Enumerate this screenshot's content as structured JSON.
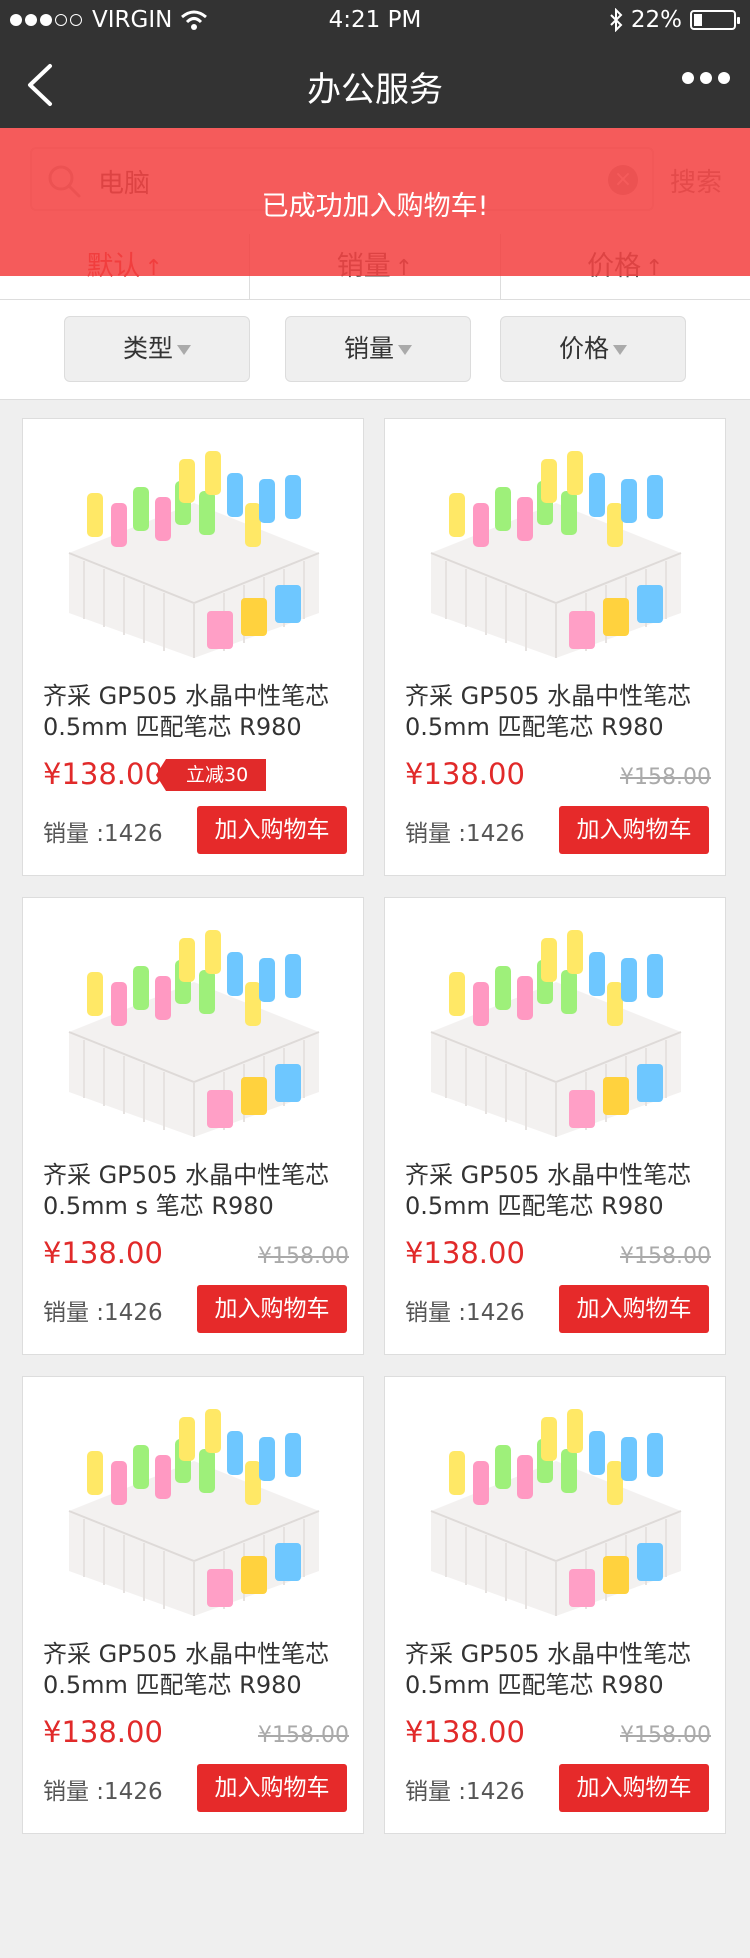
{
  "status_bar": {
    "carrier": "VIRGIN",
    "time": "4:21 PM",
    "battery": "22%",
    "battery_level": 0.22,
    "signal_icon": "signal-dots-icon",
    "wifi_icon": "wifi-icon",
    "bluetooth_icon": "bluetooth-icon"
  },
  "nav": {
    "title": "办公服务",
    "back_icon": "back-chevron-icon",
    "more_icon": "more-dots-icon"
  },
  "search": {
    "value": "电脑",
    "button": "搜索",
    "search_icon": "search-icon",
    "clear_icon": "clear-icon"
  },
  "sort": [
    {
      "label": "默认",
      "arrow": "↑",
      "active": true
    },
    {
      "label": "销量",
      "arrow": "↑",
      "active": false
    },
    {
      "label": "价格",
      "arrow": "↑",
      "active": false
    }
  ],
  "toast": {
    "message": "已成功加入购物车!"
  },
  "filters": [
    {
      "label": "类型"
    },
    {
      "label": "销量"
    },
    {
      "label": "价格"
    }
  ],
  "products": [
    {
      "name": "齐采 GP505  水晶中性笔芯 0.5mm 匹配笔芯 R980",
      "price": "¥138.00",
      "old_price": "",
      "tag": "立减30",
      "sales": "销量 :1426",
      "button": "加入购物车"
    },
    {
      "name": "齐采 GP505  水晶中性笔芯 0.5mm 匹配笔芯 R980",
      "price": "¥138.00",
      "old_price": "¥158.00",
      "tag": "",
      "sales": "销量 :1426",
      "button": "加入购物车"
    },
    {
      "name": "齐采 GP505  水晶中性笔芯 0.5mm s 笔芯 R980",
      "price": "¥138.00",
      "old_price": "¥158.00",
      "tag": "",
      "sales": "销量 :1426",
      "button": "加入购物车"
    },
    {
      "name": "齐采 GP505  水晶中性笔芯 0.5mm 匹配笔芯 R980",
      "price": "¥138.00",
      "old_price": "¥158.00",
      "tag": "",
      "sales": "销量 :1426",
      "button": "加入购物车"
    },
    {
      "name": "齐采 GP505  水晶中性笔芯 0.5mm 匹配笔芯 R980",
      "price": "¥138.00",
      "old_price": "¥158.00",
      "tag": "",
      "sales": "销量 :1426",
      "button": "加入购物车"
    },
    {
      "name": "齐采 GP505  水晶中性笔芯 0.5mm 匹配笔芯 R980",
      "price": "¥138.00",
      "old_price": "¥158.00",
      "tag": "",
      "sales": "销量 :1426",
      "button": "加入购物车"
    }
  ],
  "colors": {
    "accent": "#e62a2a",
    "toast": "#f34040",
    "nav": "#333333"
  }
}
